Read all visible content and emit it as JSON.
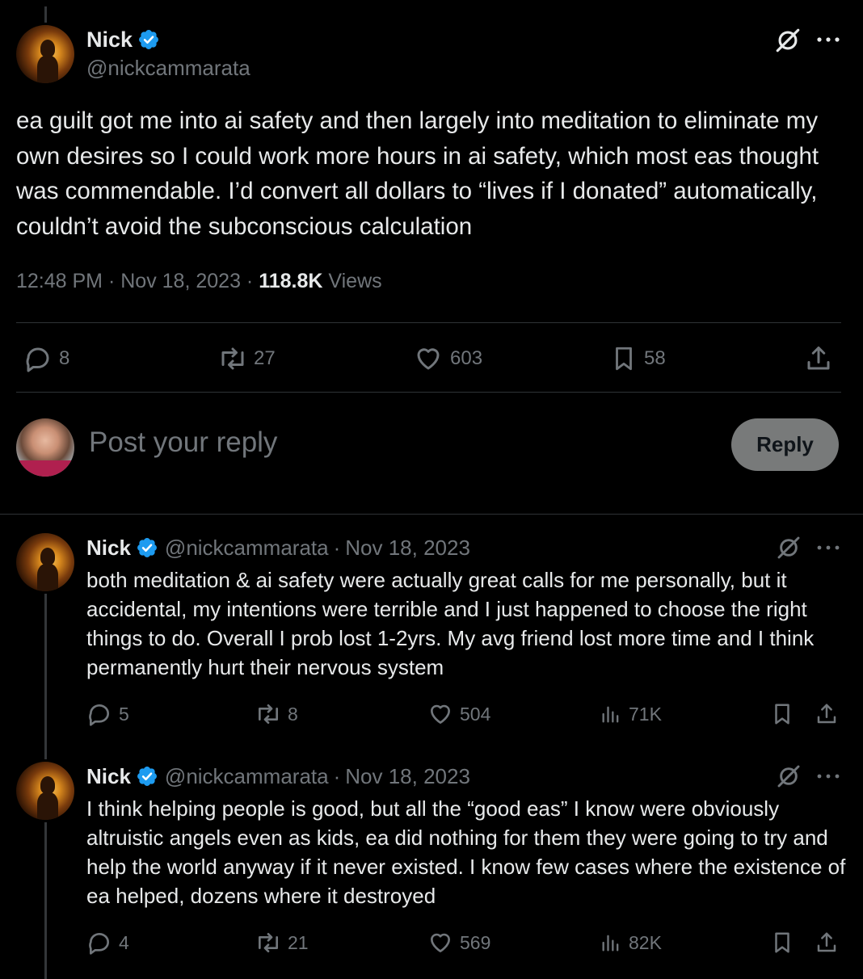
{
  "main_tweet": {
    "name": "Nick",
    "handle": "@nickcammarata",
    "text": "ea guilt got me into ai safety and then largely into meditation to eliminate my own desires so I could work more hours in ai safety, which most eas thought was commendable. I’d convert all dollars to “lives if I donated” automatically, couldn’t avoid the subconscious calculation",
    "time": "12:48 PM",
    "date": "Nov 18, 2023",
    "views_count": "118.8K",
    "views_label": "Views",
    "replies": "8",
    "reposts": "27",
    "likes": "603",
    "bookmarks": "58"
  },
  "composer": {
    "placeholder": "Post your reply",
    "button": "Reply"
  },
  "replies": [
    {
      "name": "Nick",
      "handle": "@nickcammarata",
      "date": "Nov 18, 2023",
      "text": "both meditation & ai safety were actually great calls for me personally, but it accidental, my intentions were terrible and I just happened to choose the right things to do. Overall I prob lost 1-2yrs. My avg friend lost more time and I think permanently hurt their nervous system",
      "replies": "5",
      "reposts": "8",
      "likes": "504",
      "views": "71K"
    },
    {
      "name": "Nick",
      "handle": "@nickcammarata",
      "date": "Nov 18, 2023",
      "text": "I think helping people is good, but all the “good eas” I know were obviously altruistic angels even as kids, ea did nothing for them they were going to try and help the world anyway if it never existed. I know few cases where the existence of ea helped, dozens where it destroyed",
      "replies": "4",
      "reposts": "21",
      "likes": "569",
      "views": "82K"
    }
  ],
  "separator": "·",
  "colors": {
    "background": "#000000",
    "text": "#e7e9ea",
    "muted": "#71767b",
    "verified": "#1d9bf0",
    "divider": "#2f3336"
  }
}
